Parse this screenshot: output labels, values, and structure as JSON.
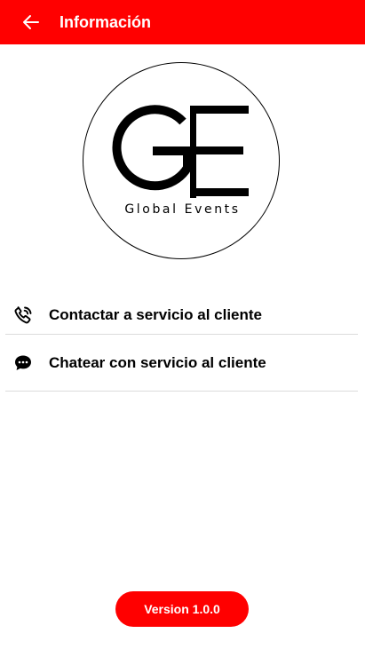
{
  "app_bar": {
    "title": "Información",
    "back_icon": "arrow-left-icon",
    "background_color": "#ff0000"
  },
  "logo": {
    "caption": "Global Events",
    "letters": "GE"
  },
  "menu": {
    "items": [
      {
        "label": "Contactar a servicio al cliente",
        "icon": "phone-call-icon"
      },
      {
        "label": "Chatear con servicio al cliente",
        "icon": "chat-bubble-icon"
      }
    ]
  },
  "footer": {
    "version_label": "Version 1.0.0",
    "button_color": "#ff0000"
  }
}
